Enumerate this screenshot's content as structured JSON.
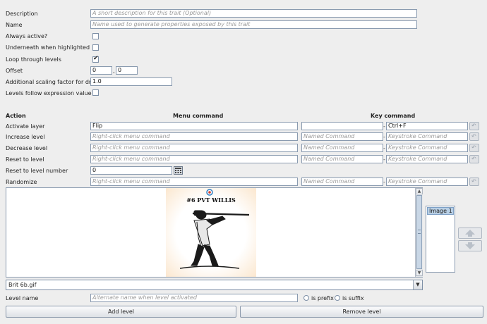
{
  "properties": {
    "description": {
      "label": "Description",
      "placeholder": "A short description for this trait (Optional)"
    },
    "name": {
      "label": "Name",
      "placeholder": "Name used to generate properties exposed by this trait"
    },
    "always_active": {
      "label": "Always active?",
      "checked": false
    },
    "underneath": {
      "label": "Underneath when highlighted",
      "checked": false
    },
    "loop": {
      "label": "Loop through levels",
      "checked": true
    },
    "offset": {
      "label": "Offset",
      "x": "0",
      "sep": ",",
      "y": "0"
    },
    "scaling": {
      "label": "Additional scaling factor for draw",
      "value": "1.0"
    },
    "follow": {
      "label": "Levels follow expression value",
      "checked": false
    }
  },
  "table": {
    "header_action": "Action",
    "header_menu": "Menu command",
    "header_key": "Key command",
    "rows": [
      {
        "label": "Activate layer",
        "menu": "Flip",
        "menu_ph": "",
        "named": "",
        "named_ph": "",
        "key": "Ctrl+F",
        "key_ph": ""
      },
      {
        "label": "Increase level",
        "menu": "",
        "menu_ph": "Right-click menu command",
        "named": "",
        "named_ph": "Named Command",
        "key": "",
        "key_ph": "Keystroke Command"
      },
      {
        "label": "Decrease level",
        "menu": "",
        "menu_ph": "Right-click menu command",
        "named": "",
        "named_ph": "Named Command",
        "key": "",
        "key_ph": "Keystroke Command"
      },
      {
        "label": "Reset to level",
        "menu": "",
        "menu_ph": "Right-click menu command",
        "named": "",
        "named_ph": "Named Command",
        "key": "",
        "key_ph": "Keystroke Command"
      },
      {
        "label": "Reset to level number",
        "value": "0"
      },
      {
        "label": "Randomize",
        "menu": "",
        "menu_ph": "Right-click menu command",
        "named": "",
        "named_ph": "Named Command",
        "key": "",
        "key_ph": "Keystroke Command"
      }
    ],
    "dash": "-"
  },
  "image_panel": {
    "picture_caption": "#6 PVT WILLIS",
    "image_select": "Brit 6b.gif",
    "level_list": [
      "Image 1"
    ]
  },
  "level_name": {
    "label": "Level name",
    "placeholder": "Alternate name when level activated"
  },
  "radio": {
    "prefix": "is prefix",
    "suffix": "is suffix"
  },
  "buttons": {
    "add": "Add level",
    "remove": "Remove level"
  },
  "colors": {
    "accent": "#b8cfe5",
    "field_border": "#8a9bb0"
  }
}
